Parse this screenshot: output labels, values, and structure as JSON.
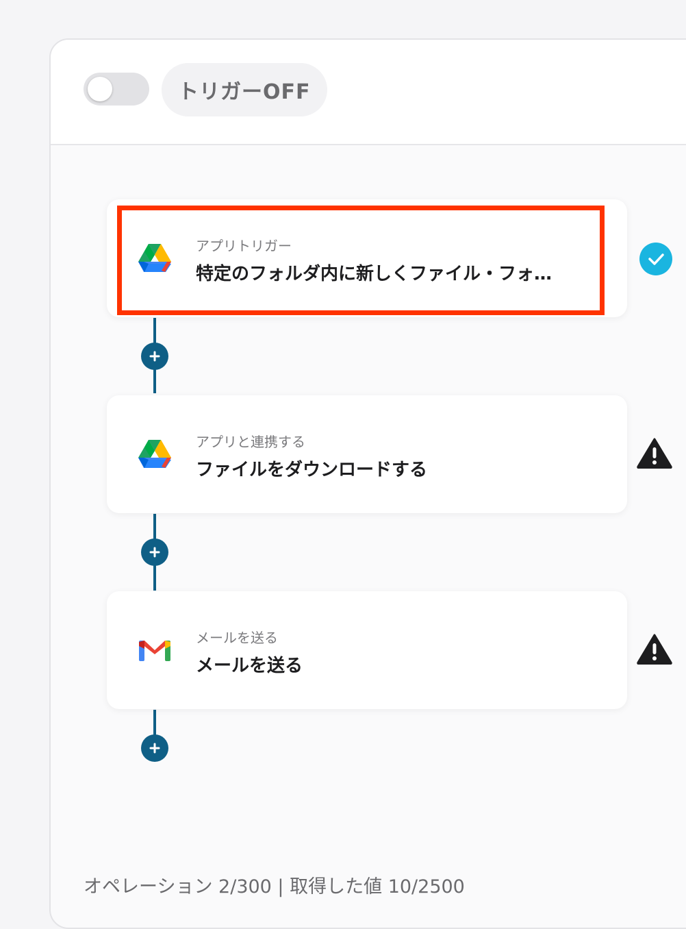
{
  "header": {
    "trigger_toggle_state": "off",
    "trigger_label": "トリガーOFF"
  },
  "flow": {
    "steps": [
      {
        "app_icon": "google-drive-icon",
        "subtitle": "アプリトリガー",
        "title": "特定のフォルダ内に新しくファイル・フォ…",
        "status": "check-icon",
        "highlighted": true
      },
      {
        "app_icon": "google-drive-icon",
        "subtitle": "アプリと連携する",
        "title": "ファイルをダウンロードする",
        "status": "warning-icon"
      },
      {
        "app_icon": "gmail-icon",
        "subtitle": "メールを送る",
        "title": "メールを送る",
        "status": "warning-icon"
      }
    ],
    "add_step_icon": "plus-icon"
  },
  "footer": {
    "usage": "オペレーション 2/300 | 取得した値 10/2500"
  },
  "colors": {
    "connector": "#0f5f86",
    "highlight": "#ff3300",
    "check": "#1ab5e0"
  }
}
